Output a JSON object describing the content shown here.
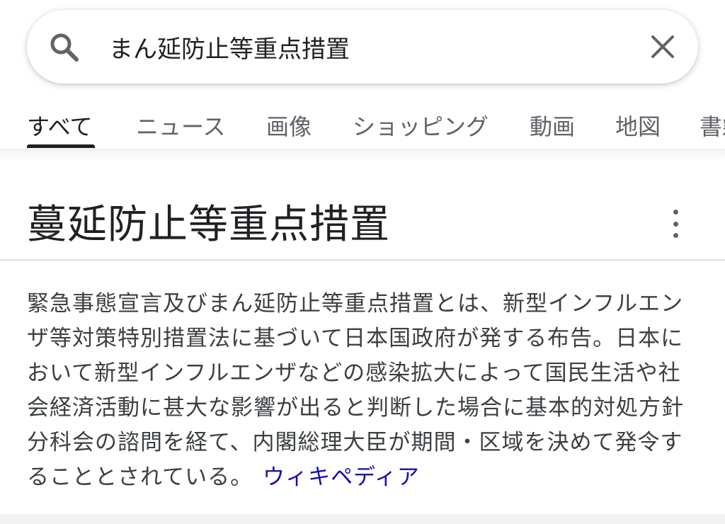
{
  "search": {
    "query": "まん延防止等重点措置"
  },
  "tabs": [
    {
      "label": "すべて"
    },
    {
      "label": "ニュース"
    },
    {
      "label": "画像"
    },
    {
      "label": "ショッピング"
    },
    {
      "label": "動画"
    },
    {
      "label": "地図"
    },
    {
      "label": "書籍"
    }
  ],
  "knowledge_panel": {
    "title": "蔓延防止等重点措置",
    "description_lines": [
      "緊急事態宣言及びまん延防止等重点措置とは、新型インフルエン",
      "ザ等対策特別措置法に基づいて日本国政府が発する布告。日本に",
      "おいて新型インフルエンザなどの感染拡大によって国民生活や社",
      "会経済活動に甚大な影響が出ると判断した場合に基本的対処方針",
      "分科会の諮問を経て、内閣総理大臣が期間・区域を決めて発令す",
      "ることとされている。"
    ],
    "source_link": "ウィキペディア"
  },
  "colors": {
    "link": "#1a0dab",
    "text": "#202124",
    "muted": "#5f6368"
  }
}
